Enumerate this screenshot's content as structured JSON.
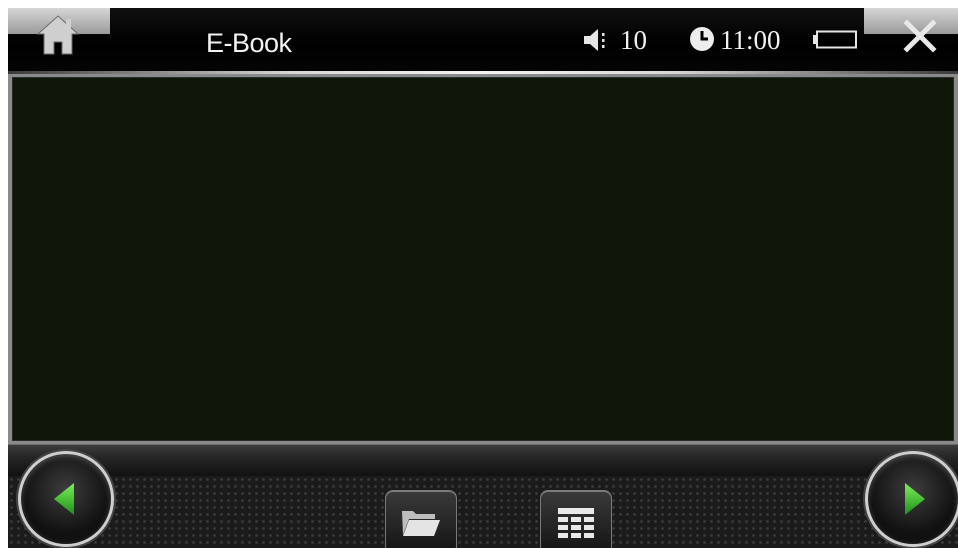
{
  "app": {
    "title": "E-Book"
  },
  "status": {
    "volume": "10",
    "time": "11:00"
  },
  "icons": {
    "home": "home-icon",
    "close": "close-icon",
    "volume": "speaker-icon",
    "clock": "clock-icon",
    "battery": "battery-icon",
    "previous": "left-arrow-icon",
    "next": "right-arrow-icon",
    "open_file": "folder-icon",
    "menu": "grid-menu-icon"
  },
  "colors": {
    "reading_background": "#0f170a",
    "arrow_green": "#2fbf2a",
    "text": "#f2f2f2"
  }
}
